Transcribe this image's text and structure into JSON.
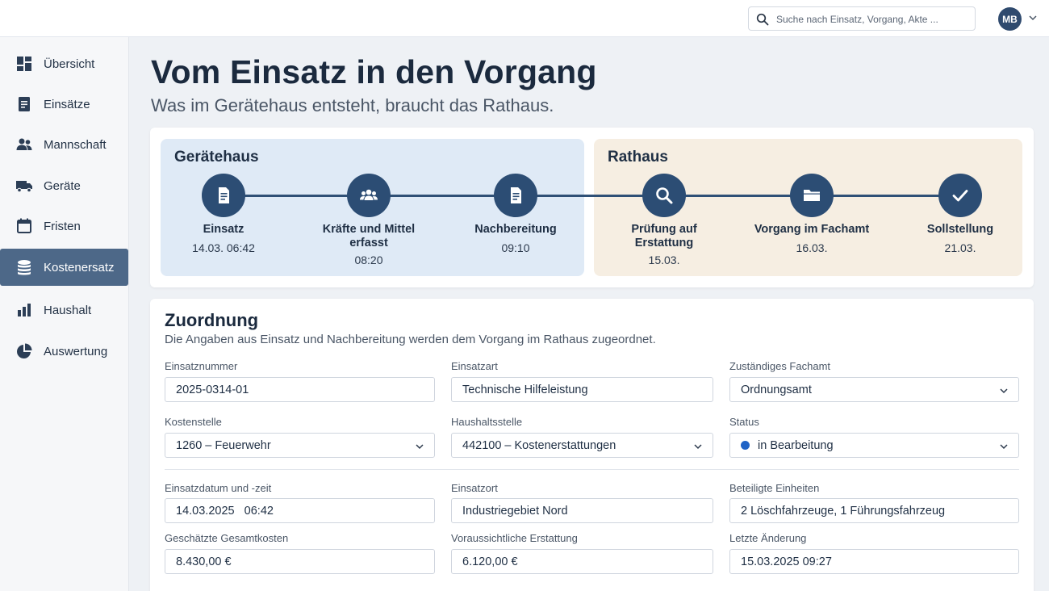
{
  "search": {
    "placeholder": "Suche nach Einsatz, Vorgang, Akte ..."
  },
  "user": {
    "initials": "MB"
  },
  "sidebar": {
    "items": [
      {
        "label": "Übersicht",
        "icon": "dashboard-icon",
        "active": false
      },
      {
        "label": "Einsätze",
        "icon": "document-icon",
        "active": false
      },
      {
        "label": "Mannschaft",
        "icon": "people-icon",
        "active": false
      },
      {
        "label": "Geräte",
        "icon": "truck-icon",
        "active": false
      },
      {
        "label": "Fristen",
        "icon": "calendar-icon",
        "active": false
      },
      {
        "label": "Kostenersatz",
        "icon": "coins-icon",
        "active": true
      },
      {
        "label": "Haushalt",
        "icon": "bar-chart-icon",
        "active": false
      },
      {
        "label": "Auswertung",
        "icon": "pie-chart-icon",
        "active": false
      }
    ]
  },
  "page": {
    "title": "Vom Einsatz in den Vorgang",
    "subtitle": "Was im Gerätehaus entsteht, braucht das Rathaus."
  },
  "flow": {
    "zone_a_title": "Gerätehaus",
    "zone_b_title": "Rathaus",
    "steps": [
      {
        "label": "Einsatz",
        "time": "14.03. 06:42",
        "icon": "document-icon"
      },
      {
        "label": "Kräfte und Mittel erfasst",
        "time": "08:20",
        "icon": "group-icon"
      },
      {
        "label": "Nachbereitung",
        "time": "09:10",
        "icon": "document-icon"
      },
      {
        "label": "Prüfung auf Erstattung",
        "time": "15.03.",
        "icon": "search-icon"
      },
      {
        "label": "Vorgang im Fachamt",
        "time": "16.03.",
        "icon": "folder-icon"
      },
      {
        "label": "Sollstellung",
        "time": "21.03.",
        "icon": "check-icon"
      }
    ]
  },
  "form": {
    "title": "Zuordnung",
    "subtitle": "Die Angaben aus Einsatz und Nachbereitung werden dem Vorgang im Rathaus zugeordnet.",
    "fields": {
      "einsatznummer": {
        "label": "Einsatznummer",
        "value": "2025-0314-01"
      },
      "einsatzart": {
        "label": "Einsatzart",
        "value": "Technische Hilfeleistung"
      },
      "fachamt": {
        "label": "Zuständiges Fachamt",
        "value": "Ordnungsamt"
      },
      "kostenstelle": {
        "label": "Kostenstelle",
        "value": "1260 – Feuerwehr"
      },
      "haushaltsstelle": {
        "label": "Haushaltsstelle",
        "value": "442100 – Kostenerstattungen"
      },
      "status": {
        "label": "Status",
        "value": "in Bearbeitung",
        "color": "#1f63c6"
      },
      "datum": {
        "label": "Einsatzdatum und -zeit",
        "value": "14.03.2025   06:42"
      },
      "ort": {
        "label": "Einsatzort",
        "value": "Industriegebiet Nord"
      },
      "einheiten": {
        "label": "Beteiligte Einheiten",
        "value": "2 Löschfahrzeuge, 1 Führungsfahrzeug"
      },
      "kosten": {
        "label": "Geschätzte Gesamtkosten",
        "value": "8.430,00 €"
      },
      "erstattung": {
        "label": "Voraussichtliche Erstattung",
        "value": "6.120,00 €"
      },
      "aenderung": {
        "label": "Letzte Änderung",
        "value": "15.03.2025 09:27"
      }
    }
  },
  "colors": {
    "accent": "#2c4d74",
    "sidebar_active": "#4d6888",
    "zone_a": "#dfeaf6",
    "zone_b": "#f6eee2"
  }
}
